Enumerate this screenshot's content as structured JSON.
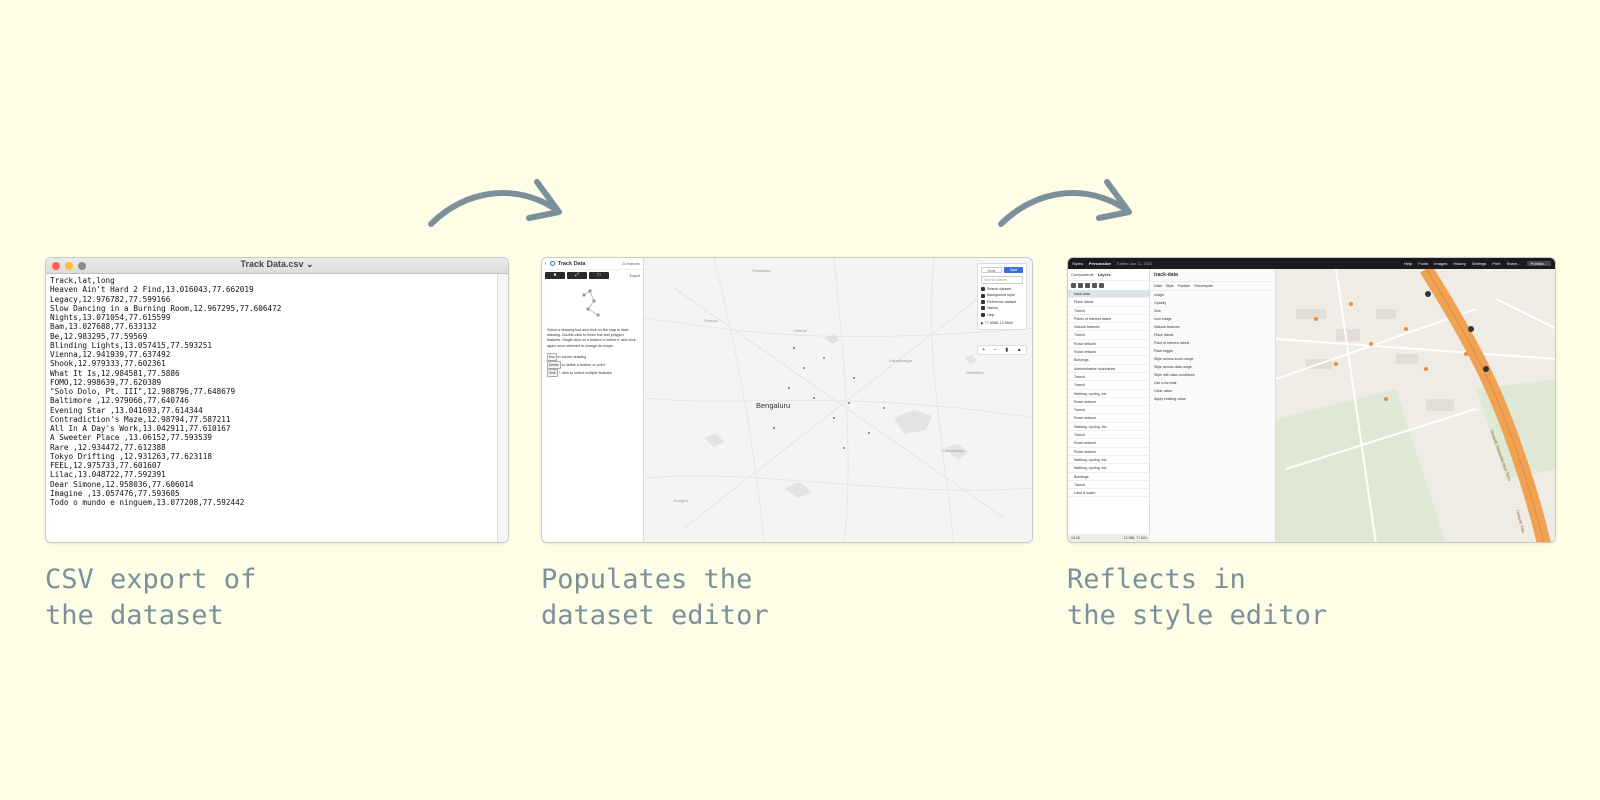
{
  "csv_window": {
    "title": "Track Data.csv",
    "lines": [
      "Track,lat,long",
      "Heaven Ain't Hard 2 Find,13.016043,77.662019",
      "Legacy,12.976782,77.599166",
      "Slow Dancing in a Burning Room,12.967295,77.606472",
      "Nights,13.071054,77.615599",
      "Bam,13.027688,77.633132",
      "Be,12.983295,77.59569",
      "Blinding Lights,13.057415,77.593251",
      "Vienna,12.941939,77.637492",
      "Shook,12.979333,77.602361",
      "What It Is,12.984581,77.5886",
      "FOMO,12.998639,77.620389",
      "\"Solo Dolo, Pt. III\",12.988796,77.648679",
      "Baltimore ,12.979066,77.640746",
      "Evening Star ,13.041693,77.614344",
      "Contradiction's Maze,12.98794,77.587211",
      "All In A Day's Work,13.042911,77.610167",
      "A Sweeter Place ,13.06152,77.593539",
      "Rare ,12.934472,77.612388",
      "Tokyo Drifting ,12.931263,77.623118",
      "FEEL,12.975733,77.601607",
      "Lilac,13.048722,77.592391",
      "Dear Simone,12.958036,77.606014",
      "Imagine ,13.057476,77.593605",
      "Todo o mundo e ninguem,13.077208,77.592442"
    ]
  },
  "dataset_editor": {
    "title": "Track Data",
    "count": "24 features",
    "export": "Export",
    "help_text": "Select a drawing tool and click on the map to start drawing. Double-click to finish line and polygon features. Single click on a feature to select it, and click again once selected to change its shape.",
    "shortcuts": [
      {
        "key": "Esc",
        "desc": "to cancel drawing"
      },
      {
        "key": "Delete",
        "desc": "to delete a feature or point"
      },
      {
        "key": "Shift",
        "desc": "+ click to select multiple features"
      }
    ],
    "map_city": "Bengaluru",
    "map_labels": [
      "Yelahanka",
      "Hebbal",
      "Gandhinagar",
      "Whitefield",
      "Carmelaram",
      "Kengeri",
      "Peenya"
    ],
    "menu": {
      "btn_cancel": "Done",
      "btn_save": "Save",
      "search_placeholder": "Search places",
      "items": [
        "Search dataset",
        "Background style",
        "Reference dataset",
        "History",
        "Help"
      ],
      "coords": "77.6068, 12.9840"
    }
  },
  "style_editor": {
    "topbar": {
      "brand": "Styles",
      "style_name": "Personalize",
      "saved": "Edited Jan 11, 2022",
      "actions": [
        "Help",
        "Fonts",
        "Images",
        "History",
        "Settings",
        "Print",
        "Share..."
      ],
      "publish": "Publish..."
    },
    "tabs": [
      "Components",
      "Layers"
    ],
    "layers": [
      "track-data",
      "Place labels",
      "Transit",
      "Points of interest labels",
      "Natural features",
      "Transit",
      "Road network",
      "Road network",
      "Buildings",
      "Administrative boundaries",
      "Transit",
      "Transit",
      "Walking, cycling, etc.",
      "Road network",
      "Transit",
      "Road network",
      "Walking, cycling, etc.",
      "Transit",
      "Road network",
      "Road network",
      "Walking, cycling, etc.",
      "Walking, cycling, etc.",
      "Buildings",
      "Transit",
      "Land & water"
    ],
    "props": {
      "title": "track-data",
      "tabs": [
        "Data",
        "Style",
        "Position",
        "Recompute"
      ],
      "lines": [
        "Image",
        "Opacity",
        "Size",
        "Icon image",
        "Natural features",
        "Place labels",
        "Point of interest labels",
        "Paint toggle",
        "Style across zoom range",
        "Style across data range",
        "Style with data conditions",
        "Use a formula",
        "Clear value",
        "Apply existing value"
      ]
    },
    "status": {
      "zoom": "13.26",
      "coords": "12.985, 77.604"
    },
    "map_labels": [
      "Towards Yelahanka New Town",
      "Towards Yela"
    ]
  },
  "captions": {
    "csv": "CSV export of\nthe dataset",
    "dataset": "Populates the\ndataset editor",
    "style": "Reflects in\nthe style editor"
  }
}
